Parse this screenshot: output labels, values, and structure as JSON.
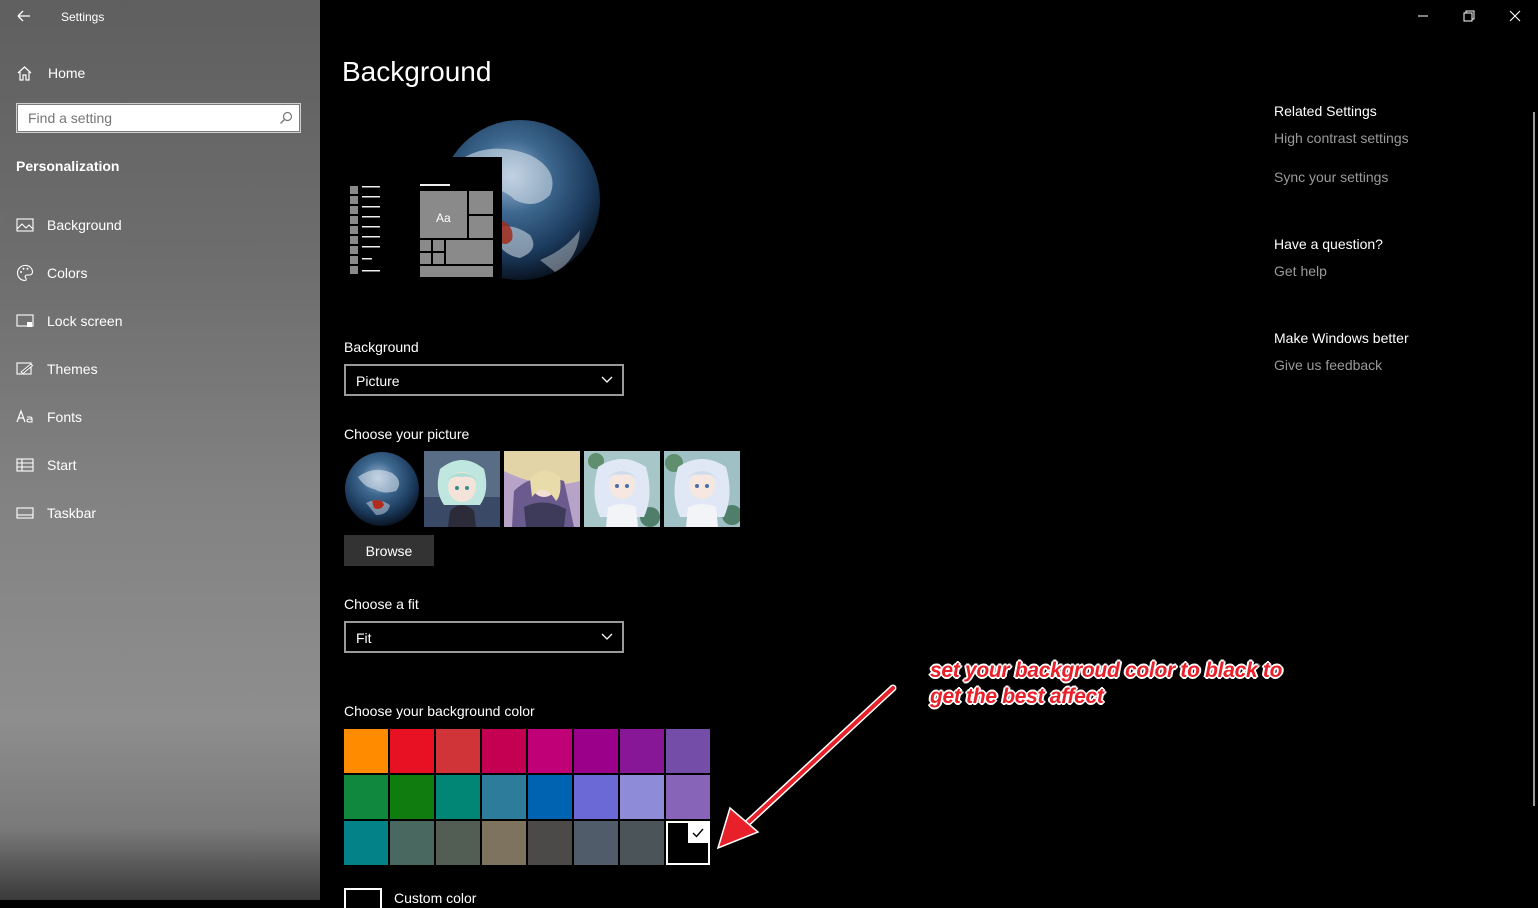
{
  "window": {
    "title": "Settings"
  },
  "sidebar": {
    "home_label": "Home",
    "search_placeholder": "Find a setting",
    "section_heading": "Personalization",
    "items": [
      {
        "label": "Background",
        "icon": "picture-icon",
        "selected": true
      },
      {
        "label": "Colors",
        "icon": "palette-icon",
        "selected": false
      },
      {
        "label": "Lock screen",
        "icon": "lock-screen-icon",
        "selected": false
      },
      {
        "label": "Themes",
        "icon": "brush-icon",
        "selected": false
      },
      {
        "label": "Fonts",
        "icon": "font-icon",
        "selected": false
      },
      {
        "label": "Start",
        "icon": "start-icon",
        "selected": false
      },
      {
        "label": "Taskbar",
        "icon": "taskbar-icon",
        "selected": false
      }
    ]
  },
  "main": {
    "title": "Background",
    "preview_tile_text": "Aa",
    "background": {
      "label": "Background",
      "value": "Picture"
    },
    "choose_picture": {
      "label": "Choose your picture",
      "browse_label": "Browse"
    },
    "fit": {
      "label": "Choose a fit",
      "value": "Fit"
    },
    "color": {
      "label": "Choose your background color",
      "swatches": [
        "#ff8c00",
        "#e81123",
        "#d13438",
        "#c30052",
        "#bf0077",
        "#9a0089",
        "#881798",
        "#744da9",
        "#10893e",
        "#107c10",
        "#018574",
        "#2d7d9a",
        "#0063b1",
        "#6b69d6",
        "#8e8cd8",
        "#8764b8",
        "#038387",
        "#486860",
        "#525e54",
        "#7e735f",
        "#4c4a48",
        "#515c6b",
        "#4a5459",
        "#000000"
      ],
      "selected_index": 23,
      "custom_label": "Custom color"
    }
  },
  "related": {
    "heading": "Related Settings",
    "links": [
      "High contrast settings",
      "Sync your settings"
    ],
    "question_heading": "Have a question?",
    "help_link": "Get help",
    "feedback_heading": "Make Windows better",
    "feedback_link": "Give us feedback"
  },
  "annotation": {
    "line1": "set your backgroud color to black to",
    "line2": "get the best affect",
    "color": "#e8202a"
  }
}
